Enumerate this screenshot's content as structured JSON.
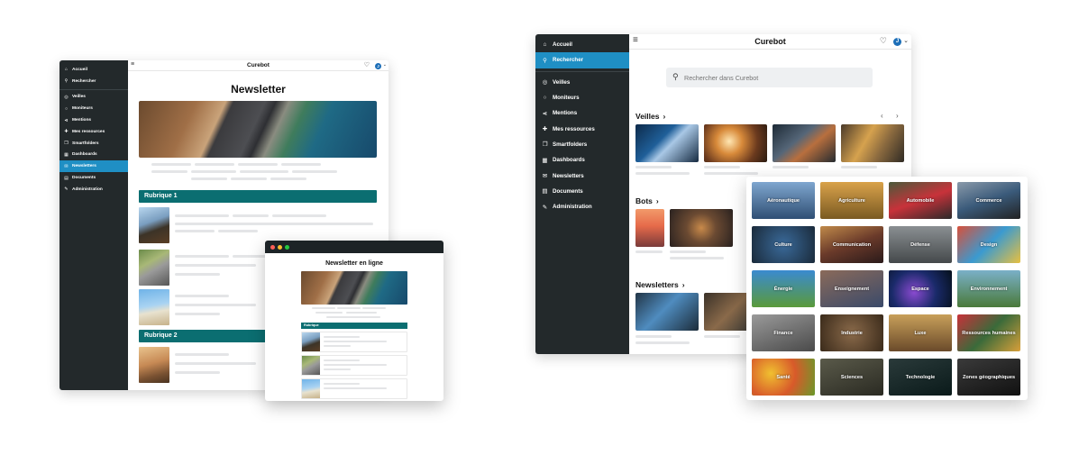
{
  "brand": "Curebot",
  "avatar_initial": "J",
  "sidebar": {
    "items": [
      {
        "label": "Accueil",
        "icon": "home-icon"
      },
      {
        "label": "Rechercher",
        "icon": "search-icon"
      },
      {
        "label": "Veilles",
        "icon": "watch-icon"
      },
      {
        "label": "Moniteurs",
        "icon": "monitor-icon"
      },
      {
        "label": "Mentions",
        "icon": "share-icon"
      },
      {
        "label": "Mes ressources",
        "icon": "resources-icon"
      },
      {
        "label": "Smartfolders",
        "icon": "folder-icon"
      },
      {
        "label": "Dashboards",
        "icon": "grid-icon"
      },
      {
        "label": "Newsletters",
        "icon": "mail-icon"
      },
      {
        "label": "Documents",
        "icon": "document-icon"
      },
      {
        "label": "Administration",
        "icon": "wrench-icon"
      }
    ]
  },
  "newsletter": {
    "title": "Newsletter",
    "sections": [
      "Rubrique 1",
      "Rubrique 2"
    ]
  },
  "popup": {
    "title": "Newsletter en ligne",
    "section": "Rubrique"
  },
  "search": {
    "placeholder": "Rechercher dans Curebot"
  },
  "right_sections": {
    "veilles": "Veilles",
    "bots": "Bots",
    "newsletters": "Newsletters"
  },
  "categories": [
    "Aéronautique",
    "Agriculture",
    "Automobile",
    "Commerce",
    "Culture",
    "Communication",
    "Défense",
    "Design",
    "Énergie",
    "Enseignement",
    "Espace",
    "Environnement",
    "Finance",
    "Industrie",
    "Luxe",
    "Ressources humaines",
    "Santé",
    "Sciences",
    "Technologie",
    "Zones géographiques"
  ],
  "colors": {
    "sidebar": "#23292b",
    "active": "#1f8fc4",
    "rubrique": "#0b6e71"
  }
}
